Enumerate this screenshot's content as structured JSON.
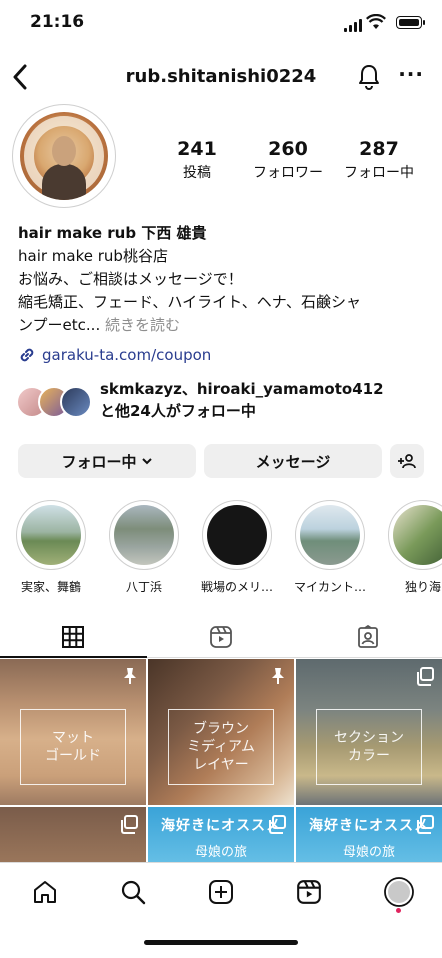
{
  "status_bar": {
    "time": "21:16"
  },
  "header": {
    "username": "rub.shitanishi0224",
    "more_label": "···"
  },
  "profile": {
    "stats": [
      {
        "value": "241",
        "label": "投稿"
      },
      {
        "value": "260",
        "label": "フォロワー"
      },
      {
        "value": "287",
        "label": "フォロー中"
      }
    ],
    "display_name": "hair make rub 下西 雄貴",
    "bio_lines": [
      "hair make rub桃谷店",
      "お悩み、ご相談はメッセージで！",
      "縮毛矯正、フェード、ハイライト、ヘナ、石鹸シャ",
      "ンプーetc..."
    ],
    "bio_more": " 続きを読む",
    "link": "garaku-ta.com/coupon",
    "followed_by_line1": "skmkazyz、hiroaki_yamamoto412",
    "followed_by_line2": "と他24人がフォロー中"
  },
  "actions": {
    "following_label": "フォロー中",
    "message_label": "メッセージ"
  },
  "highlights": [
    {
      "label": "実家、舞鶴"
    },
    {
      "label": "八丁浜"
    },
    {
      "label": "戦場のメリ…"
    },
    {
      "label": "マイカント…"
    },
    {
      "label": "独り海"
    }
  ],
  "posts": [
    {
      "overlay": "マット\nゴールド",
      "pinned": true
    },
    {
      "overlay": "ブラウン\nミディアム\nレイヤー",
      "pinned": true
    },
    {
      "overlay": "セクション\nカラー",
      "pinned": false
    },
    {
      "overlay": "",
      "pinned": false
    },
    {
      "banner": "海好きにオススメ",
      "sub": "母娘の旅"
    },
    {
      "banner": "海好きにオススメ",
      "sub": "母娘の旅"
    }
  ],
  "colors": {
    "link": "#2a3d8f",
    "button_bg": "#efefef",
    "notification_dot": "#e0245e"
  }
}
